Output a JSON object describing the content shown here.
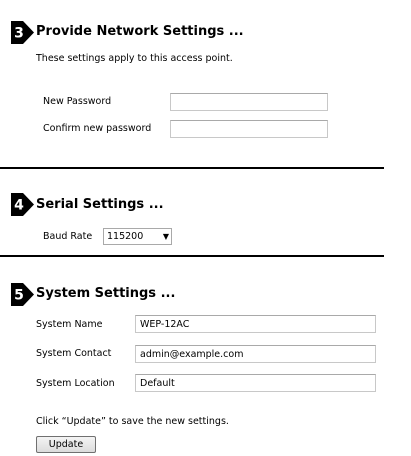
{
  "network": {
    "step": "3",
    "title": "Provide Network Settings ...",
    "description": "These settings apply to this access point.",
    "new_password_label": "New Password",
    "new_password_value": "",
    "confirm_password_label": "Confirm new password",
    "confirm_password_value": ""
  },
  "serial": {
    "step": "4",
    "title": "Serial Settings ...",
    "baud_rate_label": "Baud Rate",
    "baud_rate_value": "115200"
  },
  "system": {
    "step": "5",
    "title": "System Settings ...",
    "name_label": "System Name",
    "name_value": "WEP-12AC",
    "contact_label": "System Contact",
    "contact_value": "admin@example.com",
    "location_label": "System Location",
    "location_value": "Default",
    "update_hint": "Click “Update” to save the new settings.",
    "update_button": "Update"
  },
  "icons": {
    "step_badge": "step-number-arrow-icon",
    "dropdown": "chevron-down-icon"
  },
  "colors": {
    "badge": "#000000",
    "badge_text": "#ffffff",
    "divider": "#000000"
  }
}
